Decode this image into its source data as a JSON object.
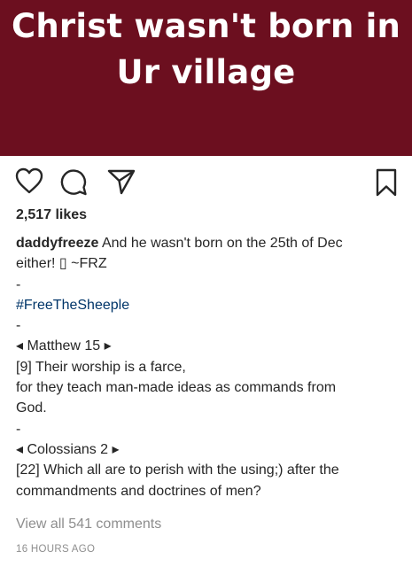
{
  "post_image": {
    "line1": "Christ wasn't born in",
    "line2": "Ur village",
    "background_color": "#6c0f1f"
  },
  "actions": {
    "like_icon": "heart-icon",
    "comment_icon": "comment-icon",
    "share_icon": "share-icon",
    "save_icon": "bookmark-icon"
  },
  "likes": "2,517 likes",
  "caption": {
    "username": "daddyfreeze",
    "text_line1": " And he wasn't born on the 25th of Dec",
    "text_line2": "either! ▯ ~FRZ",
    "dash1": "-",
    "hashtag": "#FreeTheSheeple",
    "dash2": "-",
    "ref1": "◂ Matthew 15 ▸",
    "verse1_line1": "[9] Their worship is a farce,",
    "verse1_line2": "for they teach man-made ideas as commands from",
    "verse1_line3": "God.",
    "dash3": "-",
    "ref2": "◂ Colossians 2 ▸",
    "verse2_line1": "[22] Which all are to perish with the using;) after the",
    "verse2_line2": "commandments and doctrines of men?"
  },
  "view_comments": "View all 541 comments",
  "timestamp": "16 HOURS AGO",
  "colors": {
    "text": "#262626",
    "muted": "#8e8e8e",
    "hashtag": "#003569"
  }
}
